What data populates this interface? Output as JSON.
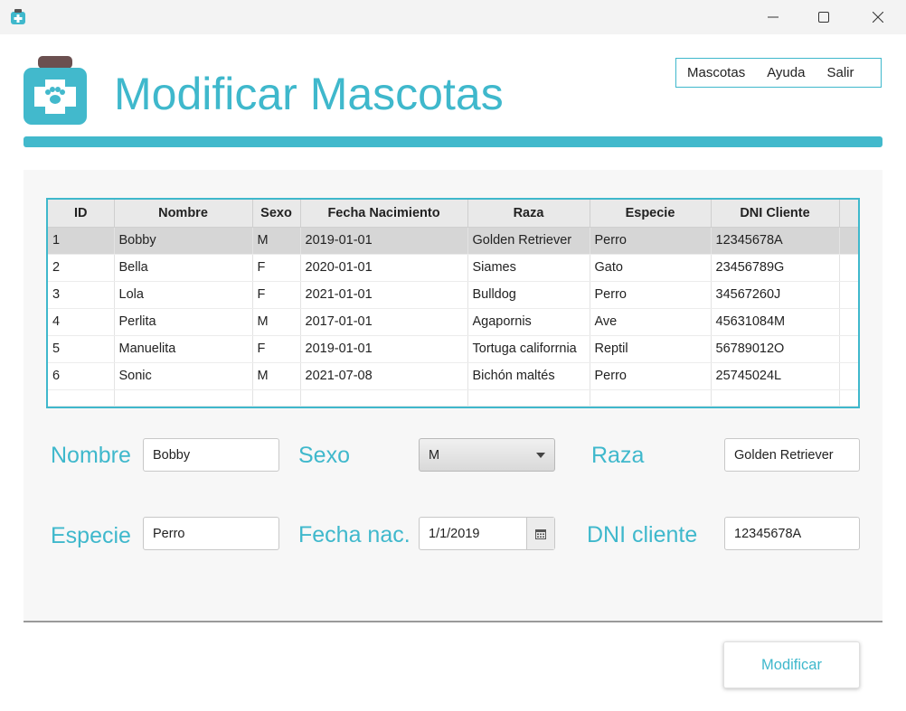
{
  "window": {
    "controls": {
      "minimize_icon": "minimize-icon",
      "maximize_icon": "maximize-icon",
      "close_icon": "close-icon"
    }
  },
  "header": {
    "title": "Modificar Mascotas",
    "logo_icon": "pet-medicine-jar-icon"
  },
  "menu": {
    "items": [
      "Mascotas",
      "Ayuda",
      "Salir"
    ]
  },
  "colors": {
    "accent": "#3fb8cc",
    "selected_row": "#d6d6d6",
    "header_bg": "#e9e9e9"
  },
  "table": {
    "columns": [
      "ID",
      "Nombre",
      "Sexo",
      "Fecha Nacimiento",
      "Raza",
      "Especie",
      "DNI Cliente"
    ],
    "rows": [
      [
        "1",
        "Bobby",
        "M",
        "2019-01-01",
        "Golden Retriever",
        "Perro",
        "12345678A"
      ],
      [
        "2",
        "Bella",
        "F",
        "2020-01-01",
        "Siames",
        "Gato",
        "23456789G"
      ],
      [
        "3",
        "Lola",
        "F",
        "2021-01-01",
        "Bulldog",
        "Perro",
        "34567260J"
      ],
      [
        "4",
        "Perlita",
        "M",
        "2017-01-01",
        "Agapornis",
        "Ave",
        "45631084M"
      ],
      [
        "5",
        "Manuelita",
        "F",
        "2019-01-01",
        "Tortuga califorrnia",
        "Reptil",
        "56789012O"
      ],
      [
        "6",
        "Sonic",
        "M",
        "2021-07-08",
        "Bichón maltés",
        "Perro",
        "25745024L"
      ]
    ],
    "selected_row": 0
  },
  "form": {
    "nombre": {
      "label": "Nombre",
      "value": "Bobby"
    },
    "sexo": {
      "label": "Sexo",
      "value": "M",
      "icon": "chevron-down-icon"
    },
    "raza": {
      "label": "Raza",
      "value": "Golden Retriever"
    },
    "especie": {
      "label": "Especie",
      "value": "Perro"
    },
    "fecha": {
      "label": "Fecha nac.",
      "value": "1/1/2019",
      "icon": "calendar-icon"
    },
    "dni": {
      "label": "DNI cliente",
      "value": "12345678A"
    }
  },
  "actions": {
    "modify_label": "Modificar"
  }
}
